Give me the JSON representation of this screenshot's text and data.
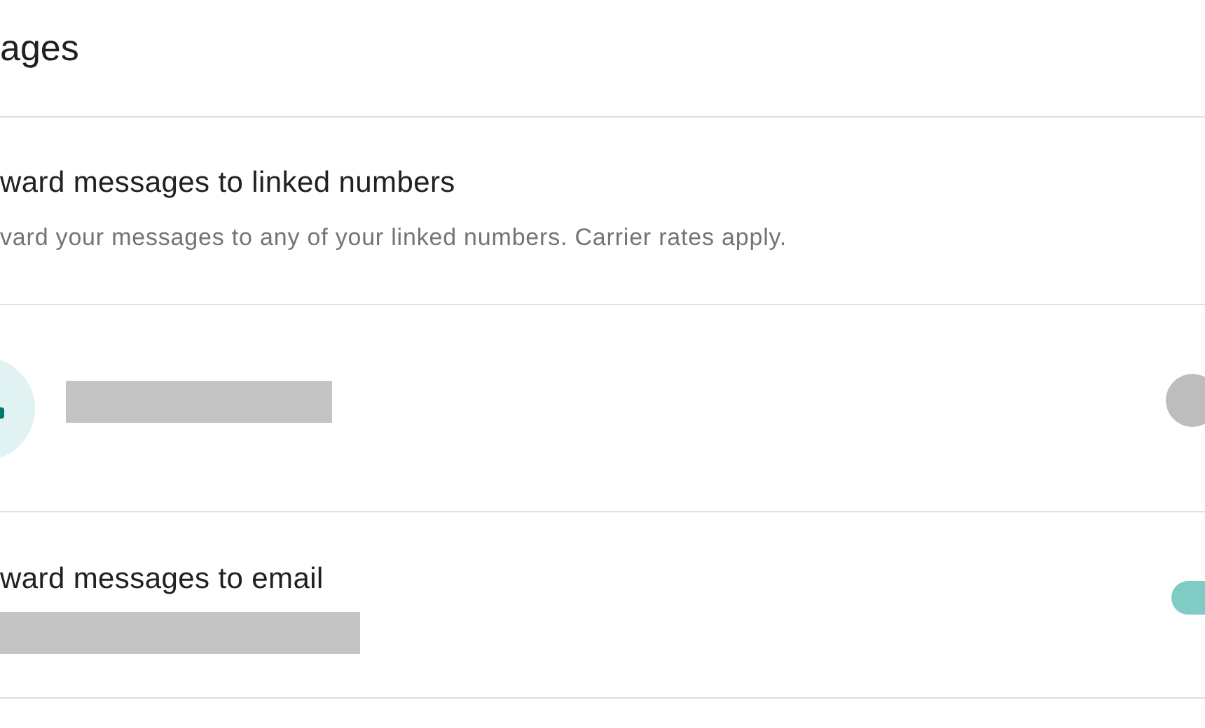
{
  "header": {
    "title": "ages"
  },
  "section": {
    "title": "ward messages to linked numbers",
    "subtitle": "vard your messages to any of your linked numbers. Carrier rates apply."
  },
  "rows": [
    {
      "kind": "linked",
      "on": false
    },
    {
      "kind": "email",
      "title": "ward messages to email",
      "on": true
    }
  ]
}
